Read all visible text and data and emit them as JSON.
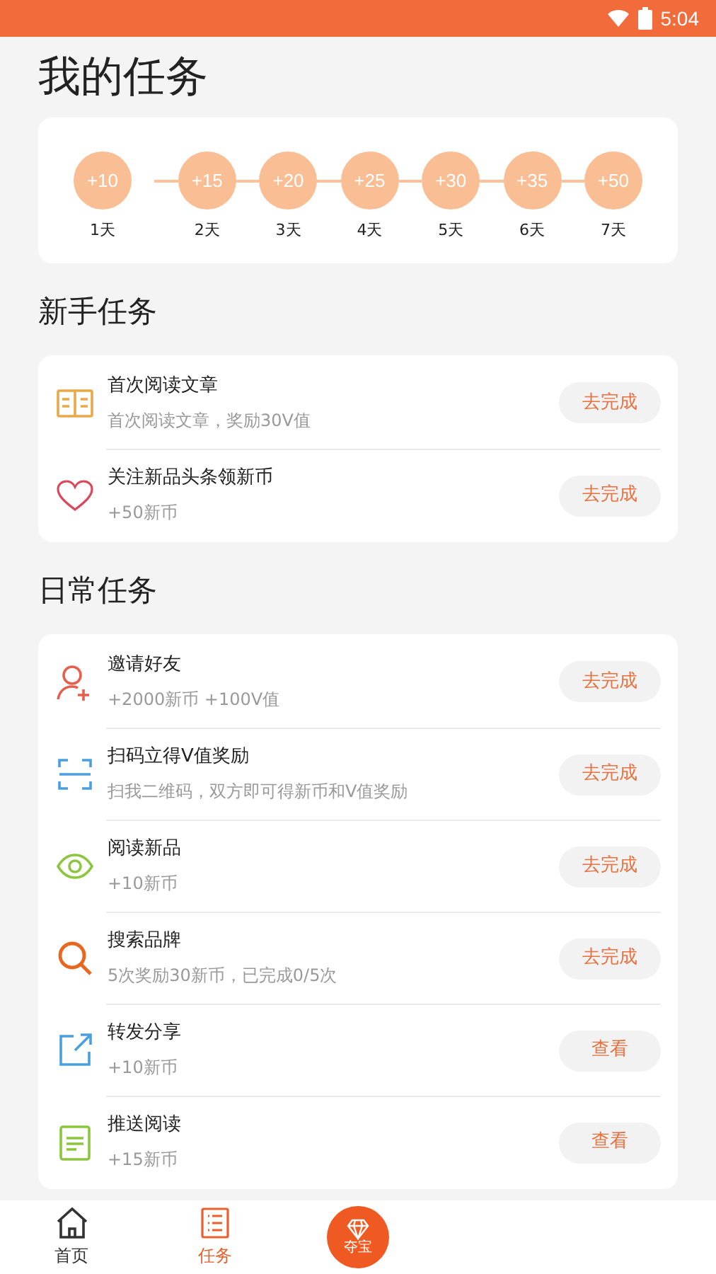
{
  "status_bar": {
    "time": "5:04"
  },
  "title": "我的任务",
  "checkin": [
    {
      "reward": "+10",
      "day": "1天"
    },
    {
      "reward": "+15",
      "day": "2天"
    },
    {
      "reward": "+20",
      "day": "3天"
    },
    {
      "reward": "+25",
      "day": "4天"
    },
    {
      "reward": "+30",
      "day": "5天"
    },
    {
      "reward": "+35",
      "day": "6天"
    },
    {
      "reward": "+50",
      "day": "7天"
    }
  ],
  "sections": [
    {
      "heading": "新手任务",
      "tasks": [
        {
          "title": "首次阅读文章",
          "detail": "首次阅读文章，奖励30V值",
          "action": "去完成"
        },
        {
          "title": "关注新品头条领新币",
          "detail": "+50新币",
          "action": "去完成"
        }
      ]
    },
    {
      "heading": "日常任务",
      "tasks": [
        {
          "title": "邀请好友",
          "detail": "+2000新币 +100V值",
          "action": "去完成"
        },
        {
          "title": "扫码立得V值奖励",
          "detail": "扫我二维码，双方即可得新币和V值奖励",
          "action": "去完成"
        },
        {
          "title": "阅读新品",
          "detail": "+10新币",
          "action": "去完成"
        },
        {
          "title": "搜索品牌",
          "detail": "5次奖励30新币，已完成0/5次",
          "action": "去完成"
        },
        {
          "title": "转发分享",
          "detail": "+10新币",
          "action": "查看"
        },
        {
          "title": "推送阅读",
          "detail": "+15新币",
          "action": "查看"
        }
      ]
    }
  ],
  "nav": [
    {
      "label": "首页",
      "kind": "home",
      "selected": false
    },
    {
      "label": "任务",
      "kind": "list",
      "selected": true
    },
    {
      "label": "夺宝",
      "kind": "center",
      "selected": false
    }
  ]
}
